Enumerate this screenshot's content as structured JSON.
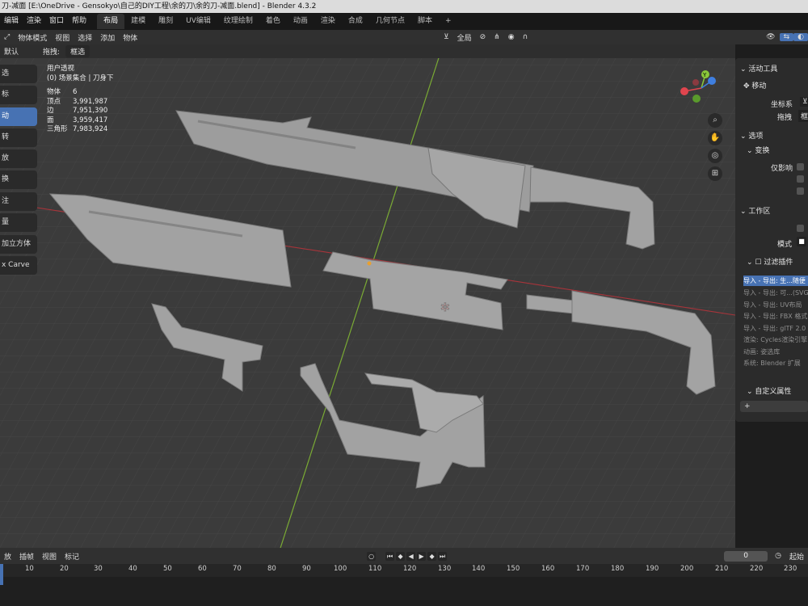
{
  "window": {
    "title": "刀-减面 [E:\\OneDrive - Gensokyo\\自己的DIY工程\\余的刀\\余的刀-减面.blend] - Blender 4.3.2"
  },
  "menubar": {
    "items": [
      "编辑",
      "渲染",
      "窗口",
      "帮助"
    ]
  },
  "workspaces": [
    "布局",
    "建模",
    "雕刻",
    "UV编辑",
    "纹理绘制",
    "着色",
    "动画",
    "渲染",
    "合成",
    "几何节点",
    "脚本",
    "+"
  ],
  "header": {
    "mode": "物体模式",
    "menus": [
      "视图",
      "选择",
      "添加",
      "物体"
    ],
    "transform_orientation": "全局"
  },
  "header2": {
    "orientation_label": "默认",
    "drag_label": "拖拽:",
    "drag_value": "框选"
  },
  "viewport": {
    "view_name": "用户透视",
    "collection": "(0) 场景集合 | 刀身下",
    "stats": [
      {
        "label": "物体",
        "value": "6"
      },
      {
        "label": "顶点",
        "value": "3,991,987"
      },
      {
        "label": "边",
        "value": "7,951,390"
      },
      {
        "label": "面",
        "value": "3,959,417"
      },
      {
        "label": "三角形",
        "value": "7,983,924"
      }
    ],
    "gizmo": {
      "x": "X",
      "y": "Y",
      "z": "Z"
    }
  },
  "toolbar": {
    "items": [
      "选",
      "标",
      "动",
      "转",
      "放",
      "换",
      "注",
      "量",
      "加立方体",
      "x Carve"
    ],
    "active_index": 2
  },
  "right_panel": {
    "active_tool_title": "活动工具",
    "move_label": "移动",
    "coord_label": "坐标系",
    "drag_label": "拖拽",
    "drag_value": "框",
    "options_title": "选项",
    "transform_title": "变换",
    "affect_only_label": "仅影响",
    "workspace_title": "工作区",
    "mode_label": "模式",
    "filter_addons_title": "过滤插件",
    "addons": [
      "导入 - 导出: 生...随便",
      "导入 - 导出: 可...(SVG)",
      "导入 - 导出: UV布局",
      "导入 - 导出: FBX 格式",
      "导入 - 导出: glTF 2.0",
      "渲染: Cycles渲染引擎",
      "动画: 姿选库",
      "系统: Blender 扩展"
    ],
    "custom_props_title": "自定义属性",
    "add_label": "+"
  },
  "timeline": {
    "menus": [
      "放",
      "插帧",
      "视图",
      "标记"
    ],
    "current_frame": "0",
    "start_label": "起始",
    "ticks": [
      "10",
      "20",
      "30",
      "40",
      "50",
      "60",
      "70",
      "80",
      "90",
      "100",
      "110",
      "120",
      "130",
      "140",
      "150",
      "160",
      "170",
      "180",
      "190",
      "200",
      "210",
      "220",
      "230"
    ]
  },
  "colors": {
    "accent": "#4772b3",
    "viewport_bg": "#3b3b3b",
    "mesh": "#9b9b9b",
    "x_axis": "#e0454e",
    "y_axis": "#8ac83a",
    "z_axis": "#3f7fe0"
  }
}
